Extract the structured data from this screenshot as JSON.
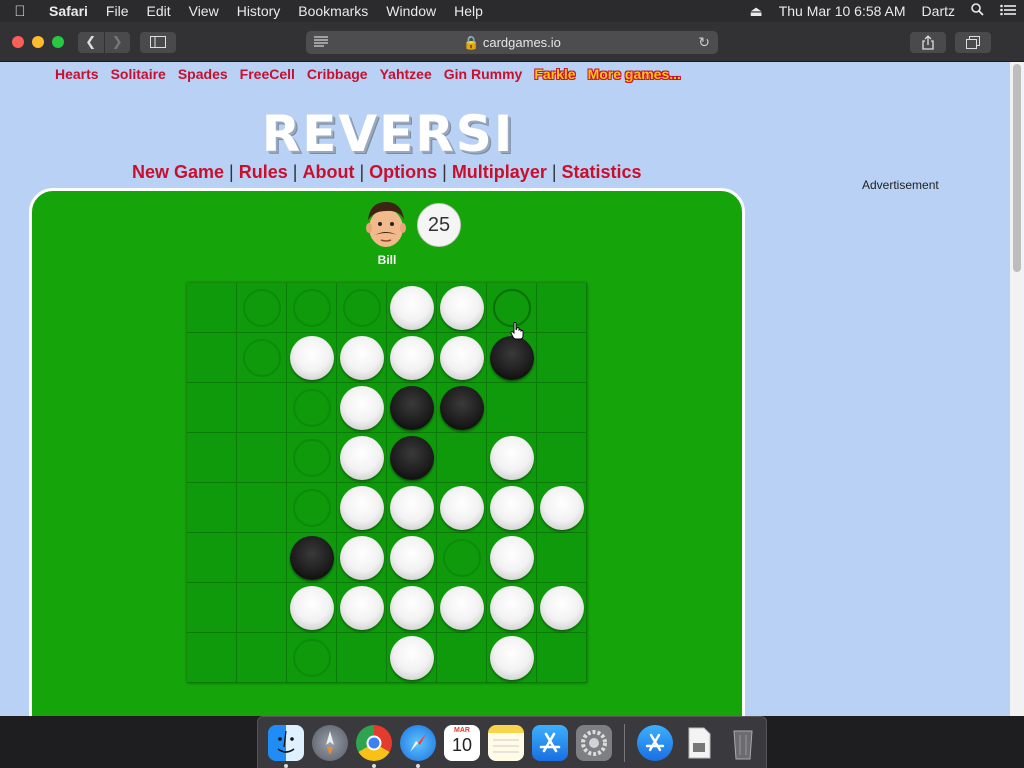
{
  "menubar": {
    "app": "Safari",
    "items": [
      "File",
      "Edit",
      "View",
      "History",
      "Bookmarks",
      "Window",
      "Help"
    ],
    "datetime": "Thu Mar 10  6:58 AM",
    "user": "Dartz"
  },
  "browser": {
    "url": "cardgames.io"
  },
  "site_nav": {
    "links": [
      "Hearts",
      "Solitaire",
      "Spades",
      "FreeCell",
      "Cribbage",
      "Yahtzee",
      "Gin Rummy"
    ],
    "highlight_links": [
      "Farkle",
      "More games..."
    ]
  },
  "logo": "REVERSI",
  "game_menu": [
    "New Game",
    "Rules",
    "About",
    "Options",
    "Multiplayer",
    "Statistics"
  ],
  "advertisement": "Advertisement",
  "opponent": {
    "name": "Bill",
    "score": "25"
  },
  "board": [
    [
      ".",
      "h",
      "h",
      "h",
      "W",
      "W",
      "H",
      "."
    ],
    [
      ".",
      "h",
      "W",
      "W",
      "W",
      "W",
      "B",
      "."
    ],
    [
      ".",
      ".",
      "h",
      "W",
      "B",
      "B",
      ".",
      "."
    ],
    [
      ".",
      ".",
      "h",
      "W",
      "B",
      ".",
      "W",
      "."
    ],
    [
      ".",
      ".",
      "h",
      "W",
      "W",
      "W",
      "W",
      "W"
    ],
    [
      ".",
      ".",
      "B",
      "W",
      "W",
      "h",
      "W",
      "."
    ],
    [
      ".",
      ".",
      "W",
      "W",
      "W",
      "W",
      "W",
      "W"
    ],
    [
      ".",
      ".",
      "h",
      ".",
      "W",
      ".",
      "W",
      "."
    ]
  ],
  "dock": {
    "apps": [
      "finder",
      "launchpad",
      "chrome",
      "safari",
      "calendar",
      "notes",
      "app-store",
      "system-preferences"
    ],
    "calendar_month": "MAR",
    "calendar_day": "10",
    "extras": [
      "downloads",
      "document",
      "trash"
    ]
  }
}
